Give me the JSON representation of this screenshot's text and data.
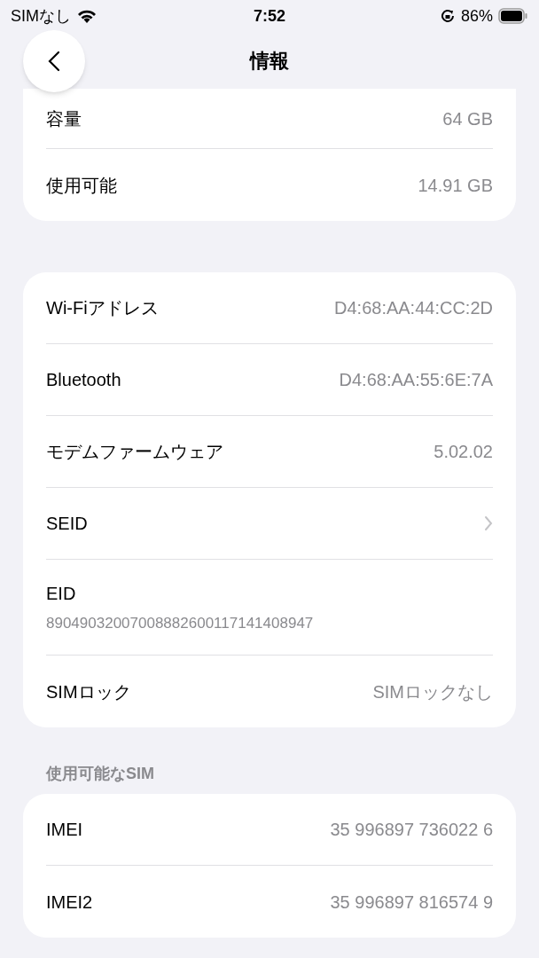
{
  "status_bar": {
    "carrier": "SIMなし",
    "time": "7:52",
    "battery": "86%"
  },
  "nav": {
    "title": "情報"
  },
  "sections": [
    {
      "cut_top": true,
      "rows": [
        {
          "kind": "value",
          "label": "容量",
          "value": "64 GB"
        },
        {
          "kind": "value",
          "label": "使用可能",
          "value": "14.91 GB"
        }
      ]
    },
    {
      "rows": [
        {
          "kind": "value",
          "label": "Wi-Fiアドレス",
          "value": "D4:68:AA:44:CC:2D"
        },
        {
          "kind": "value",
          "label": "Bluetooth",
          "value": "D4:68:AA:55:6E:7A"
        },
        {
          "kind": "value",
          "label": "モデムファームウェア",
          "value": "5.02.02"
        },
        {
          "kind": "chevron",
          "label": "SEID"
        },
        {
          "kind": "stacked",
          "label": "EID",
          "value": "89049032007008882600117141408947"
        },
        {
          "kind": "value",
          "label": "SIMロック",
          "value": "SIMロックなし"
        }
      ]
    },
    {
      "header": "使用可能なSIM",
      "rows": [
        {
          "kind": "value",
          "label": "IMEI",
          "value": "35 996897 736022 6"
        },
        {
          "kind": "value",
          "label": "IMEI2",
          "value": "35 996897 816574 9"
        }
      ]
    }
  ]
}
